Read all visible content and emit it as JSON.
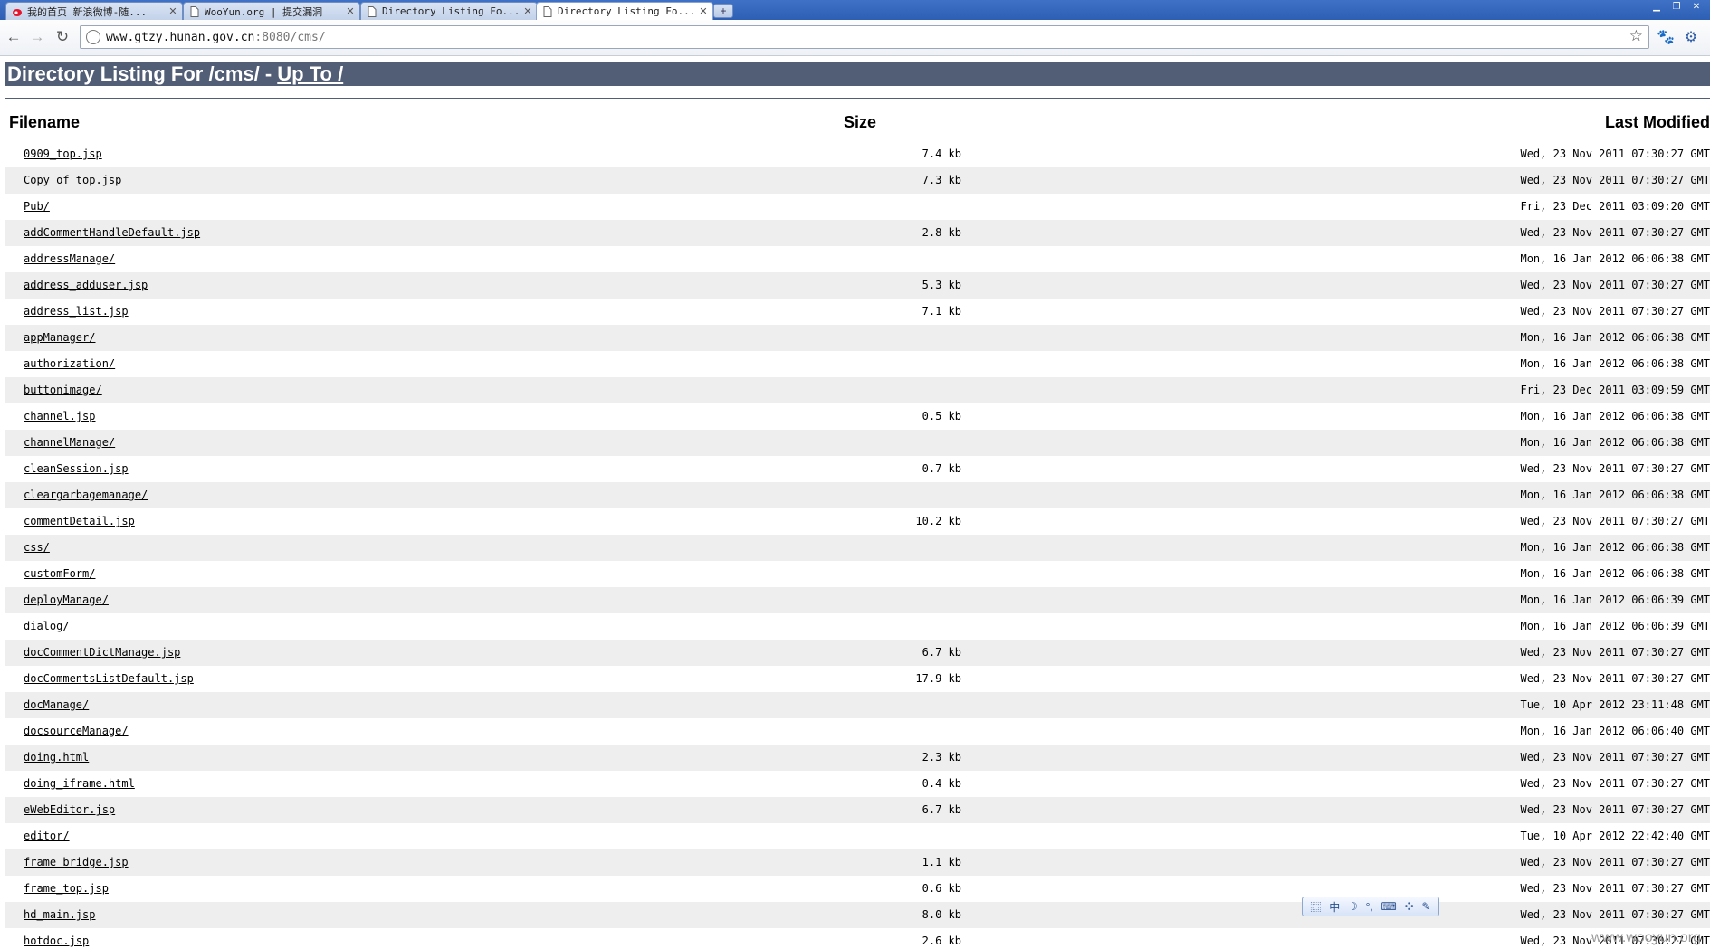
{
  "browser": {
    "tabs": [
      {
        "label": "我的首页 新浪微博-随...",
        "icon": "weibo-icon"
      },
      {
        "label": "WooYun.org | 提交漏洞",
        "icon": "page-icon"
      },
      {
        "label": "Directory Listing Fo...",
        "icon": "page-icon"
      },
      {
        "label": "Directory Listing Fo...",
        "icon": "page-icon"
      }
    ],
    "new_tab_label": "+",
    "url_host": "www.gtzy.hunan.gov.cn",
    "url_path": ":8080/cms/"
  },
  "page": {
    "heading_prefix": "Directory Listing For /cms/ - ",
    "heading_link": "Up To /",
    "columns": {
      "filename": "Filename",
      "size": "Size",
      "modified": "Last Modified"
    },
    "rows": [
      {
        "name": "0909_top.jsp",
        "size": "7.4 kb",
        "modified": "Wed, 23 Nov 2011 07:30:27 GMT"
      },
      {
        "name": "Copy of top.jsp",
        "size": "7.3 kb",
        "modified": "Wed, 23 Nov 2011 07:30:27 GMT"
      },
      {
        "name": "Pub/",
        "size": "",
        "modified": "Fri, 23 Dec 2011 03:09:20 GMT"
      },
      {
        "name": "addCommentHandleDefault.jsp",
        "size": "2.8 kb",
        "modified": "Wed, 23 Nov 2011 07:30:27 GMT"
      },
      {
        "name": "addressManage/",
        "size": "",
        "modified": "Mon, 16 Jan 2012 06:06:38 GMT"
      },
      {
        "name": "address_adduser.jsp",
        "size": "5.3 kb",
        "modified": "Wed, 23 Nov 2011 07:30:27 GMT"
      },
      {
        "name": "address_list.jsp",
        "size": "7.1 kb",
        "modified": "Wed, 23 Nov 2011 07:30:27 GMT"
      },
      {
        "name": "appManager/",
        "size": "",
        "modified": "Mon, 16 Jan 2012 06:06:38 GMT"
      },
      {
        "name": "authorization/",
        "size": "",
        "modified": "Mon, 16 Jan 2012 06:06:38 GMT"
      },
      {
        "name": "buttonimage/",
        "size": "",
        "modified": "Fri, 23 Dec 2011 03:09:59 GMT"
      },
      {
        "name": "channel.jsp",
        "size": "0.5 kb",
        "modified": "Mon, 16 Jan 2012 06:06:38 GMT"
      },
      {
        "name": "channelManage/",
        "size": "",
        "modified": "Mon, 16 Jan 2012 06:06:38 GMT"
      },
      {
        "name": "cleanSession.jsp",
        "size": "0.7 kb",
        "modified": "Wed, 23 Nov 2011 07:30:27 GMT"
      },
      {
        "name": "cleargarbagemanage/",
        "size": "",
        "modified": "Mon, 16 Jan 2012 06:06:38 GMT"
      },
      {
        "name": "commentDetail.jsp",
        "size": "10.2 kb",
        "modified": "Wed, 23 Nov 2011 07:30:27 GMT"
      },
      {
        "name": "css/",
        "size": "",
        "modified": "Mon, 16 Jan 2012 06:06:38 GMT"
      },
      {
        "name": "customForm/",
        "size": "",
        "modified": "Mon, 16 Jan 2012 06:06:38 GMT"
      },
      {
        "name": "deployManage/",
        "size": "",
        "modified": "Mon, 16 Jan 2012 06:06:39 GMT"
      },
      {
        "name": "dialog/",
        "size": "",
        "modified": "Mon, 16 Jan 2012 06:06:39 GMT"
      },
      {
        "name": "docCommentDictManage.jsp",
        "size": "6.7 kb",
        "modified": "Wed, 23 Nov 2011 07:30:27 GMT"
      },
      {
        "name": "docCommentsListDefault.jsp",
        "size": "17.9 kb",
        "modified": "Wed, 23 Nov 2011 07:30:27 GMT"
      },
      {
        "name": "docManage/",
        "size": "",
        "modified": "Tue, 10 Apr 2012 23:11:48 GMT"
      },
      {
        "name": "docsourceManage/",
        "size": "",
        "modified": "Mon, 16 Jan 2012 06:06:40 GMT"
      },
      {
        "name": "doing.html",
        "size": "2.3 kb",
        "modified": "Wed, 23 Nov 2011 07:30:27 GMT"
      },
      {
        "name": "doing_iframe.html",
        "size": "0.4 kb",
        "modified": "Wed, 23 Nov 2011 07:30:27 GMT"
      },
      {
        "name": "eWebEditor.jsp",
        "size": "6.7 kb",
        "modified": "Wed, 23 Nov 2011 07:30:27 GMT"
      },
      {
        "name": "editor/",
        "size": "",
        "modified": "Tue, 10 Apr 2012 22:42:40 GMT"
      },
      {
        "name": "frame_bridge.jsp",
        "size": "1.1 kb",
        "modified": "Wed, 23 Nov 2011 07:30:27 GMT"
      },
      {
        "name": "frame_top.jsp",
        "size": "0.6 kb",
        "modified": "Wed, 23 Nov 2011 07:30:27 GMT"
      },
      {
        "name": "hd_main.jsp",
        "size": "8.0 kb",
        "modified": "Wed, 23 Nov 2011 07:30:27 GMT"
      },
      {
        "name": "hotdoc.jsp",
        "size": "2.6 kb",
        "modified": "Wed, 23 Nov 2011 07:30:27 GMT"
      }
    ]
  },
  "ime": {
    "items": [
      "⿴",
      "中",
      "☽",
      "°,",
      "⌨",
      "✣",
      "✎"
    ]
  },
  "watermark": "www.wooyun.org",
  "colors": {
    "heading_bg": "#525d76",
    "row_alt": "#eeeeee",
    "tab_bar": "#2d5fb4"
  }
}
